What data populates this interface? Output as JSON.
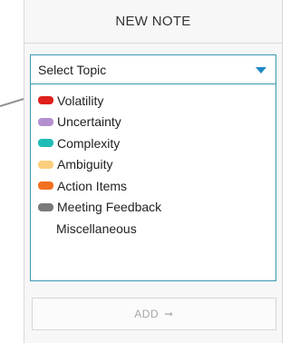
{
  "header": {
    "title": "NEW NOTE"
  },
  "select": {
    "value": "Select Topic"
  },
  "topics": [
    {
      "label": "Volatility",
      "color": "#e0201b"
    },
    {
      "label": "Uncertainty",
      "color": "#b48fd0"
    },
    {
      "label": "Complexity",
      "color": "#1fbcb6"
    },
    {
      "label": "Ambiguity",
      "color": "#fccf7e"
    },
    {
      "label": "Action Items",
      "color": "#f37021"
    },
    {
      "label": "Meeting Feedback",
      "color": "#7a7a7a"
    },
    {
      "label": "Miscellaneous",
      "color": null
    }
  ],
  "add_button": {
    "label": "ADD",
    "icon": "arrow-right-icon"
  }
}
